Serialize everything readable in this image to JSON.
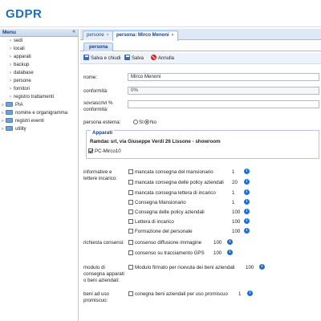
{
  "app": {
    "logo": "GDPR"
  },
  "sidebar": {
    "title": "Menu",
    "collapse_glyph": "«",
    "children": [
      "sedi",
      "locali",
      "apparati",
      "backup",
      "database",
      "persone",
      "fornitori",
      "registro trattamenti"
    ],
    "groups": [
      "PIA",
      "nomine e organigramma",
      "registri eventi",
      "utility"
    ]
  },
  "tabs": [
    {
      "label": "persone",
      "close": "×"
    },
    {
      "label": "persona: Mirco Menoni",
      "close": "×"
    }
  ],
  "subtab": "persona",
  "toolbar": {
    "save_close": "Salva e chiudi",
    "save": "Salva",
    "cancel": "Annulla"
  },
  "form": {
    "nome_label": "nome:",
    "nome_value": "Mirco Menoni",
    "conformita_label": "conformità:",
    "conformita_value": "0%",
    "sovrascrivi_label_1": "sovrascrivi %",
    "sovrascrivi_label_2": "conformità:",
    "sovrascrivi_value": "",
    "esterna_label": "persona esterna:",
    "esterna_si": "SI",
    "esterna_no": "No"
  },
  "apparati": {
    "legend": "Apparati",
    "company": "Ramdac srl, via Giuseppe Verdi 26 Lissone - showroom",
    "device": "PC-Mirco10"
  },
  "informative": {
    "label_1": "informative e",
    "label_2": "lettere incarico:",
    "items": [
      {
        "text": "mancata consegna del mansionario",
        "num": "1"
      },
      {
        "text": "mancata consegna delle policy aziendali",
        "num": "20"
      },
      {
        "text": "mancata consegna lettera di incarico",
        "num": "1"
      },
      {
        "text": "Consegna Mansionario",
        "num": "1"
      },
      {
        "text": "Consegna delle policy aziendali",
        "num": "100"
      },
      {
        "text": "Lettera di incarico",
        "num": "100"
      },
      {
        "text": "Formazione del personale",
        "num": "100"
      }
    ]
  },
  "consensi": {
    "label": "richiesta consensi:",
    "items": [
      {
        "text": "consenso diffusione immagine",
        "num": "100"
      },
      {
        "text": "consenso su tracciamento GPS",
        "num": "100"
      }
    ]
  },
  "modulo": {
    "label_1": "modulo di",
    "label_2": "consegna apparati",
    "label_3": "o beni aziendali:",
    "text": "Modulo firmato per ricevuta dei beni aziendali",
    "num": "100"
  },
  "beni": {
    "label_1": "beni ad uso",
    "label_2": "promiscuo:",
    "text": "conegna beni aziendali per uso promiscuo",
    "num": "1"
  },
  "info_glyph": "i"
}
